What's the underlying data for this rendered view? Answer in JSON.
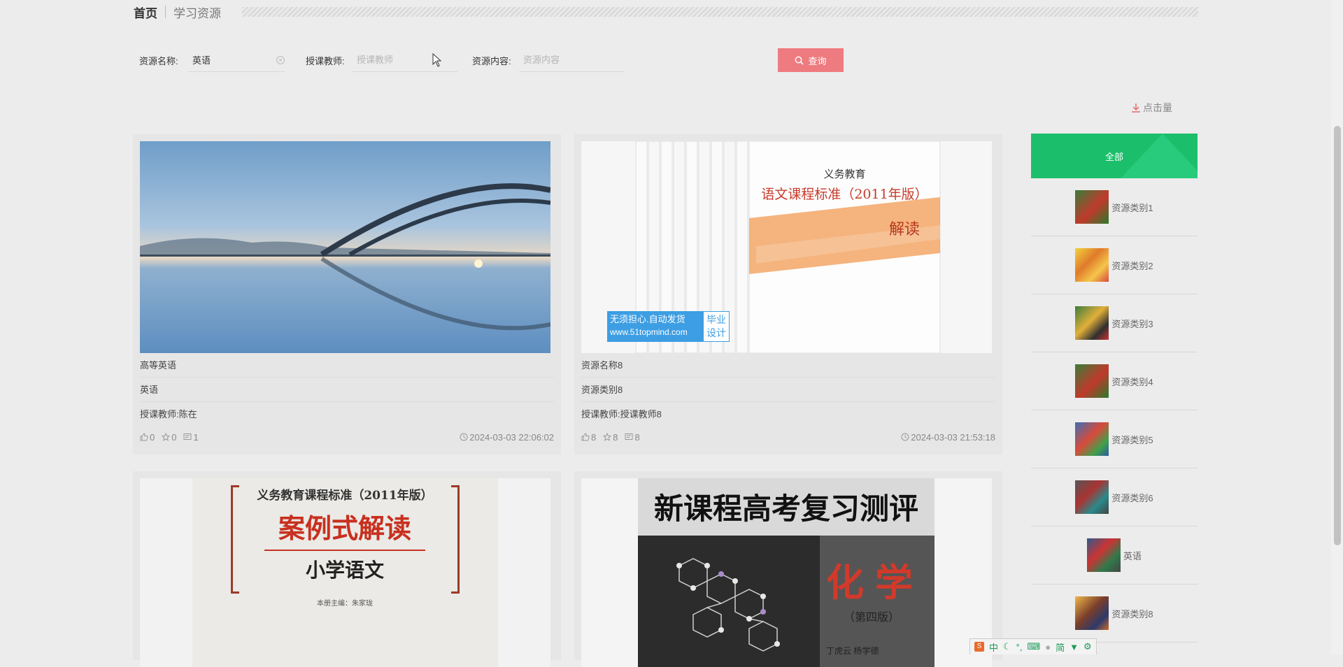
{
  "breadcrumb": {
    "home": "首页",
    "current": "学习资源"
  },
  "search": {
    "name_label": "资源名称:",
    "name_value": "英语",
    "teacher_label": "授课教师:",
    "teacher_placeholder": "授课教师",
    "content_label": "资源内容:",
    "content_placeholder": "资源内容",
    "query_label": "查询"
  },
  "sort": {
    "label": "点击量"
  },
  "cards": [
    {
      "title": "高等英语",
      "category": "英语",
      "teacher": "授课教师:陈在",
      "likes": "0",
      "favorites": "0",
      "comments": "1",
      "time": "2024-03-03 22:06:02"
    },
    {
      "title": "资源名称8",
      "category": "资源类别8",
      "teacher": "授课教师:授课教师8",
      "likes": "8",
      "favorites": "8",
      "comments": "8",
      "time": "2024-03-03 21:53:18",
      "watermark": {
        "line1": "无须担心.自动发货",
        "line2": "www.51topmind.com",
        "badge_top": "毕业",
        "badge_bottom": "设计"
      },
      "cover": {
        "top": "义务教育",
        "title": "语文课程标准（2011年版）",
        "sub": "解读"
      }
    },
    {
      "cover": {
        "top": "义务教育课程标准（2011年版）",
        "title": "案例式解读",
        "sub": "小学语文",
        "editor": "本册主编：朱家珑"
      }
    },
    {
      "cover": {
        "title": "新课程高考复习测评",
        "sub": "化学",
        "edition": "（第四版）",
        "authors": "丁虎云  杨学德"
      }
    }
  ],
  "sidebar": {
    "all_label": "全部",
    "categories": [
      "资源类别1",
      "资源类别2",
      "资源类别3",
      "资源类别4",
      "资源类别5",
      "资源类别6",
      "英语",
      "资源类别8"
    ]
  },
  "ime": {
    "mode": "中",
    "simplified": "简"
  }
}
